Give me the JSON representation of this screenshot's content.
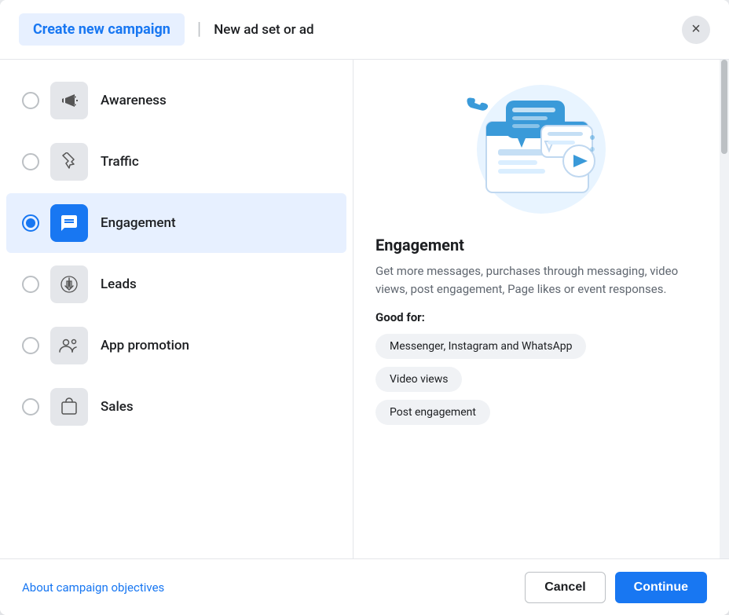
{
  "header": {
    "tab_active": "Create new campaign",
    "tab_inactive": "New ad set or ad",
    "close_label": "×"
  },
  "options": [
    {
      "id": "awareness",
      "label": "Awareness",
      "icon": "📢",
      "active": false,
      "checked": false
    },
    {
      "id": "traffic",
      "label": "Traffic",
      "icon": "↖",
      "active": false,
      "checked": false
    },
    {
      "id": "engagement",
      "label": "Engagement",
      "icon": "💬",
      "active": true,
      "checked": true
    },
    {
      "id": "leads",
      "label": "Leads",
      "icon": "⬇",
      "active": false,
      "checked": false
    },
    {
      "id": "app-promotion",
      "label": "App promotion",
      "icon": "👥",
      "active": false,
      "checked": false
    },
    {
      "id": "sales",
      "label": "Sales",
      "icon": "🛍",
      "active": false,
      "checked": false
    }
  ],
  "detail": {
    "title": "Engagement",
    "description": "Get more messages, purchases through messaging, video views, post engagement, Page likes or event responses.",
    "good_for_label": "Good for:",
    "tags": [
      "Messenger, Instagram and WhatsApp",
      "Video views",
      "Post engagement"
    ]
  },
  "footer": {
    "link_label": "About campaign objectives",
    "cancel_label": "Cancel",
    "continue_label": "Continue"
  }
}
